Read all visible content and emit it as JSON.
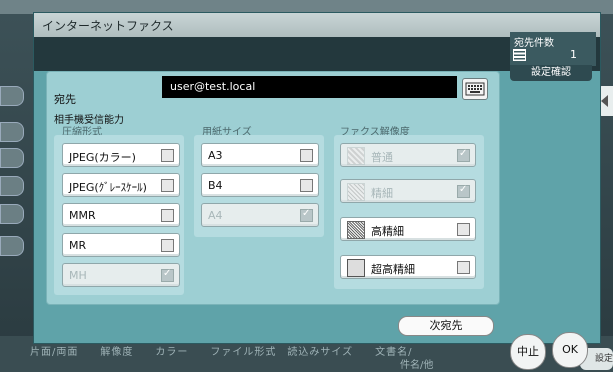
{
  "background": {
    "bottom_labels": "片面/両面　　解像度　　カラー　　ファイル形式　読込みサイズ　　文書名/",
    "bottom_labels2": "件名/他",
    "right_button": "設定"
  },
  "dialog": {
    "title": "インターネットファクス",
    "count": {
      "label": "宛先件数",
      "value": "1"
    },
    "confirm_label": "設定確認",
    "destination": {
      "label": "宛先",
      "value": "user@test.local"
    },
    "capability_title": "相手機受信能力",
    "compression": {
      "title": "圧縮形式",
      "options": [
        {
          "label": "JPEG(カラー)",
          "checked": false,
          "disabled": false
        },
        {
          "label": "JPEG(ｸﾞﾚｰｽｹｰﾙ)",
          "checked": false,
          "disabled": false
        },
        {
          "label": "MMR",
          "checked": false,
          "disabled": false
        },
        {
          "label": "MR",
          "checked": false,
          "disabled": false
        },
        {
          "label": "MH",
          "checked": true,
          "disabled": true
        }
      ]
    },
    "paper": {
      "title": "用紙サイズ",
      "options": [
        {
          "label": "A3",
          "checked": false,
          "disabled": false
        },
        {
          "label": "B4",
          "checked": false,
          "disabled": false
        },
        {
          "label": "A4",
          "checked": true,
          "disabled": true
        }
      ]
    },
    "resolution": {
      "title": "ファクス解像度",
      "options": [
        {
          "label": "普通",
          "checked": true,
          "disabled": true
        },
        {
          "label": "精細",
          "checked": true,
          "disabled": true
        },
        {
          "label": "高精細",
          "checked": false,
          "disabled": false
        },
        {
          "label": "超高精細",
          "checked": false,
          "disabled": false
        }
      ]
    },
    "next_label": "次宛先",
    "stop_label": "中止",
    "ok_label": "OK"
  }
}
